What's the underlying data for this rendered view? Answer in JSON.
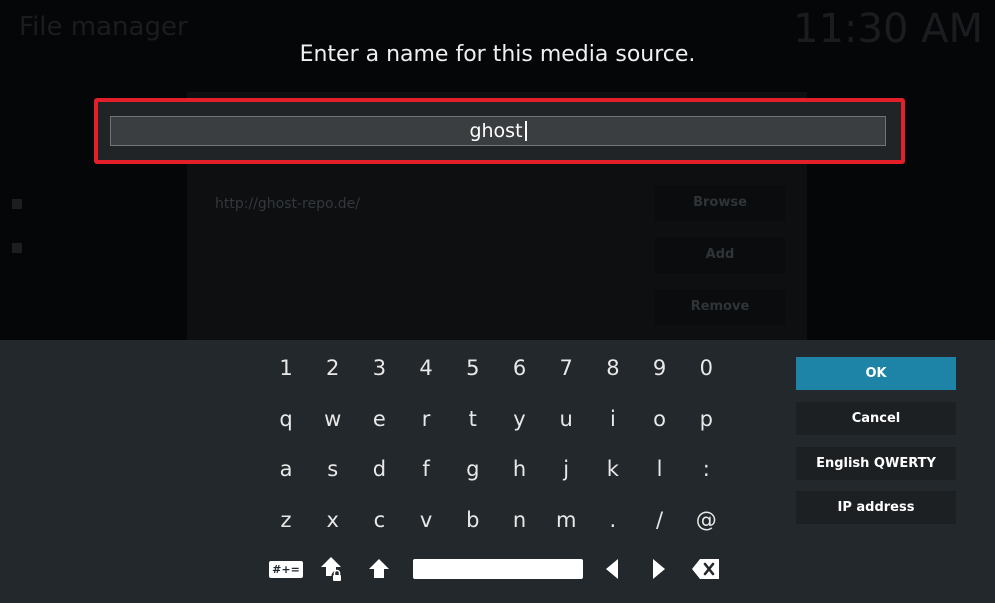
{
  "background": {
    "title": "File manager",
    "clock": "11:30 AM",
    "url": "http://ghost-repo.de/",
    "buttons": [
      "Browse",
      "Add",
      "Remove"
    ]
  },
  "dialog": {
    "heading": "Enter a name for this media source.",
    "input_value": "ghost"
  },
  "keyboard": {
    "rows": [
      [
        "1",
        "2",
        "3",
        "4",
        "5",
        "6",
        "7",
        "8",
        "9",
        "0"
      ],
      [
        "q",
        "w",
        "e",
        "r",
        "t",
        "y",
        "u",
        "i",
        "o",
        "p"
      ],
      [
        "a",
        "s",
        "d",
        "f",
        "g",
        "h",
        "j",
        "k",
        "l",
        ":"
      ],
      [
        "z",
        "x",
        "c",
        "v",
        "b",
        "n",
        "m",
        ".",
        "/",
        "@"
      ]
    ],
    "symbols_key": "#+=",
    "icons": [
      "shift-lock-icon",
      "shift-icon",
      "arrow-left-icon",
      "arrow-right-icon",
      "backspace-icon"
    ]
  },
  "actions": {
    "ok": "OK",
    "cancel": "Cancel",
    "layout": "English QWERTY",
    "ip": "IP address"
  },
  "colors": {
    "accent_ok": "#1d84a8",
    "focus_border": "#e3202a",
    "keyboard_bg": "#22282b"
  }
}
